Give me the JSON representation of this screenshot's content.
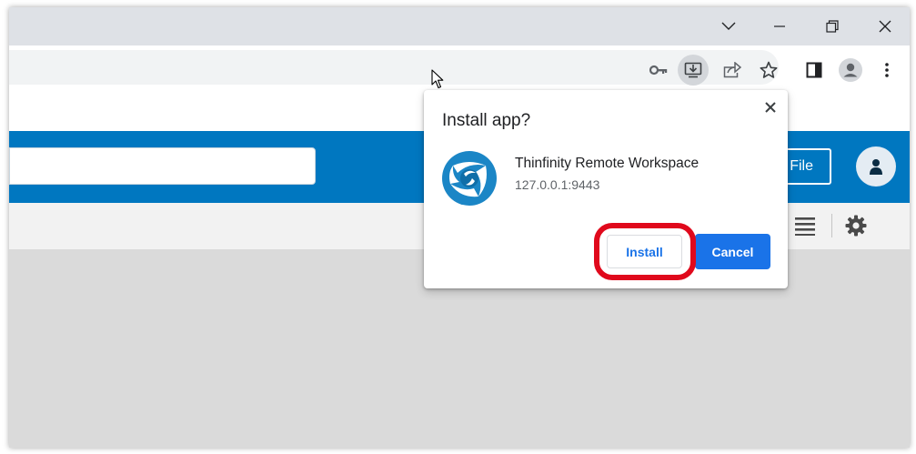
{
  "browser": {
    "window_controls": [
      "chevron-down-icon",
      "minimize-icon",
      "restore-icon",
      "close-icon"
    ],
    "toolbar_icons": [
      "key-icon",
      "install-app-icon",
      "share-icon",
      "star-icon",
      "side-panel-icon",
      "profile-icon",
      "menu-dots-icon"
    ]
  },
  "app": {
    "header_button_label": "File",
    "brand_color": "#0077c0"
  },
  "dialog": {
    "title": "Install app?",
    "app_name": "Thinfinity Remote Workspace",
    "origin": "127.0.0.1:9443",
    "install_label": "Install",
    "cancel_label": "Cancel",
    "accent_color": "#1a73e8",
    "highlight_color": "#e0091c"
  }
}
